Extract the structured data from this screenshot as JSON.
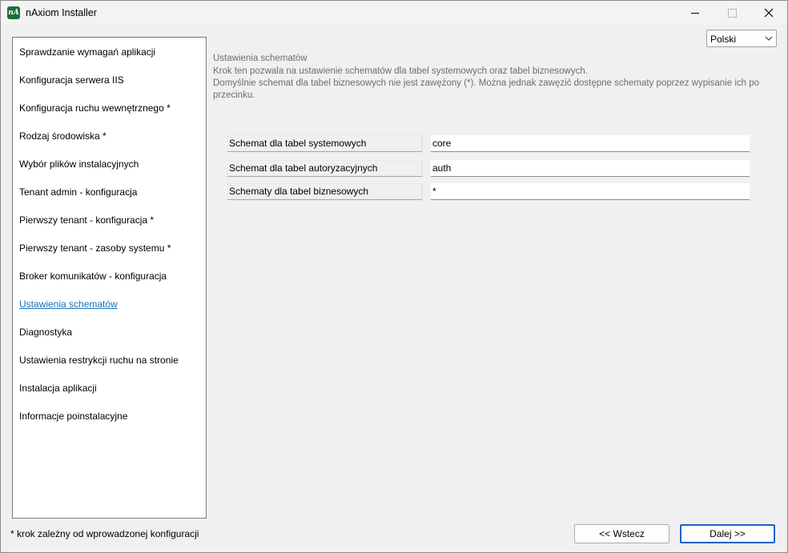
{
  "window": {
    "icon_text": "nA",
    "title": "nAxiom Installer"
  },
  "sidebar": {
    "items": [
      {
        "label": "Sprawdzanie wymagań aplikacji"
      },
      {
        "label": "Konfiguracja serwera IIS"
      },
      {
        "label": "Konfiguracja ruchu wewnętrznego *"
      },
      {
        "label": "Rodzaj środowiska *"
      },
      {
        "label": "Wybór plików instalacyjnych"
      },
      {
        "label": "Tenant admin - konfiguracja"
      },
      {
        "label": "Pierwszy tenant - konfiguracja *"
      },
      {
        "label": "Pierwszy tenant - zasoby systemu *"
      },
      {
        "label": "Broker komunikatów - konfiguracja"
      },
      {
        "label": "Ustawienia schematów"
      },
      {
        "label": "Diagnostyka"
      },
      {
        "label": "Ustawienia restrykcji ruchu na stronie"
      },
      {
        "label": "Instalacja aplikacji"
      },
      {
        "label": "Informacje poinstalacyjne"
      }
    ],
    "active_index": 9
  },
  "language": {
    "selected": "Polski"
  },
  "main": {
    "title": "Ustawienia schematów",
    "description_lines": [
      "Krok ten pozwala na ustawienie schematów dla tabel systemowych oraz tabel biznesowych.",
      "Domyślnie schemat dla tabel biznesowych nie jest zawężony (*). Można jednak zawęzić dostępne schematy poprzez wypisanie ich po przecinku."
    ],
    "fields": [
      {
        "label": "Schemat dla tabel systemowych",
        "value": "core"
      },
      {
        "label": "Schemat dla tabel autoryzacyjnych",
        "value": "auth"
      },
      {
        "label": "Schematy dla tabel biznesowych",
        "value": "*"
      }
    ]
  },
  "footer": {
    "note": "* krok zależny od wprowadzonej konfiguracji",
    "back_label": "<< Wstecz",
    "next_label": "Dalej >>"
  },
  "colors": {
    "active_link": "#1a6fb3",
    "default_button_border": "#1d63c4",
    "app_icon_bg": "#1d6f3a"
  }
}
